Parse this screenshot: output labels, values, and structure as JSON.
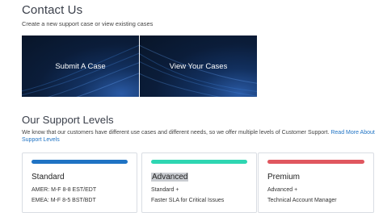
{
  "contact": {
    "title": "Contact Us",
    "subtitle": "Create a new support case or view existing cases",
    "submit_label": "Submit A Case",
    "view_label": "View Your Cases"
  },
  "support": {
    "title": "Our Support Levels",
    "description": "We know that our customers have different use cases and different needs, so we offer multiple levels of Customer Support.",
    "link": "Read More About Support Levels",
    "levels": [
      {
        "name": "Standard",
        "color": "#1f73c4",
        "line1": "AMER: M-F 8-8 EST/EDT",
        "line2": "EMEA: M-F 8-5 BST/BDT"
      },
      {
        "name": "Advanced",
        "color": "#2ed6b2",
        "line1": "Standard +",
        "line2": "Faster SLA for Critical Issues"
      },
      {
        "name": "Premium",
        "color": "#e0575f",
        "line1": "Advanced +",
        "line2": "Technical Account Manager"
      }
    ]
  }
}
